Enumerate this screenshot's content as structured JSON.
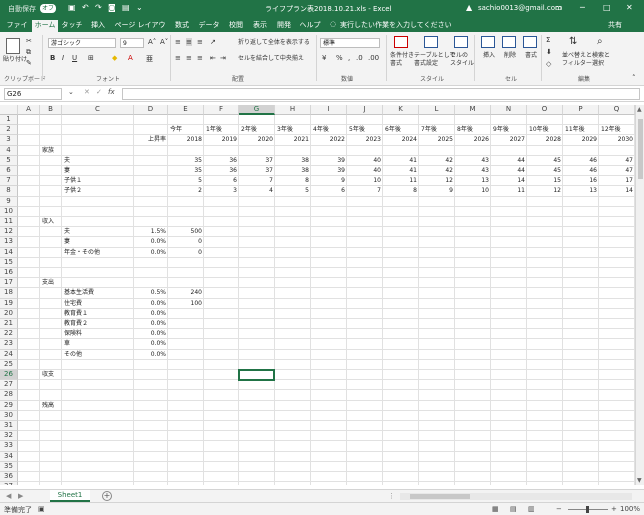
{
  "titlebar": {
    "autosave_label": "自動保存",
    "autosave_state": "オフ",
    "doc_title": "ライフプラン表2018.10.21.xls  -  Excel",
    "user_email": "sachio0013@gmail.com"
  },
  "tabs": [
    "ファイル",
    "ホーム",
    "タッチ",
    "挿入",
    "ページ レイアウト",
    "数式",
    "データ",
    "校閲",
    "表示",
    "開発",
    "ヘルプ"
  ],
  "search_placeholder": "実行したい作業を入力してください",
  "share_label": "共有",
  "ribbon": {
    "paste_label": "貼り付け",
    "font_name": "游ゴシック",
    "font_size": "9",
    "wrap_text": "折り返して全体を表示する",
    "merge_center": "セルを結合して中央揃え",
    "number_format": "標準",
    "cond_format": "条件付き\n書式",
    "table_format": "テーブルとして\n書式設定",
    "cell_styles": "セルの\nスタイル",
    "insert": "挿入",
    "delete": "削除",
    "format": "書式",
    "sort_filter": "並べ替えと\nフィルター",
    "find_select": "検索と\n選択",
    "groups": [
      "クリップボード",
      "フォント",
      "配置",
      "数値",
      "スタイル",
      "セル",
      "編集"
    ]
  },
  "namebox": "G26",
  "columns": [
    "A",
    "B",
    "C",
    "D",
    "E",
    "F",
    "G",
    "H",
    "I",
    "J",
    "K",
    "L",
    "M",
    "N",
    "O",
    "P",
    "Q"
  ],
  "rows": [
    "1",
    "2",
    "3",
    "4",
    "5",
    "6",
    "7",
    "8",
    "9",
    "10",
    "11",
    "12",
    "13",
    "14",
    "15",
    "16",
    "17",
    "18",
    "19",
    "20",
    "21",
    "22",
    "23",
    "24",
    "25",
    "26",
    "27",
    "28",
    "29",
    "30",
    "31",
    "32",
    "33",
    "34",
    "35",
    "36",
    "37"
  ],
  "sheet": {
    "row2": {
      "D": "",
      "E": "今年",
      "F": "1年後",
      "G": "2年後",
      "H": "3年後",
      "I": "4年後",
      "J": "5年後",
      "K": "6年後",
      "L": "7年後",
      "M": "8年後",
      "N": "9年後",
      "O": "10年後",
      "P": "11年後",
      "Q": "12年後"
    },
    "row3": {
      "D": "上昇率",
      "E": "2018",
      "F": "2019",
      "G": "2020",
      "H": "2021",
      "I": "2022",
      "J": "2023",
      "K": "2024",
      "L": "2025",
      "M": "2026",
      "N": "2027",
      "O": "2028",
      "P": "2029",
      "Q": "2030"
    },
    "row4": {
      "B": "家族"
    },
    "row5": {
      "C": "夫",
      "E": "35",
      "F": "36",
      "G": "37",
      "H": "38",
      "I": "39",
      "J": "40",
      "K": "41",
      "L": "42",
      "M": "43",
      "N": "44",
      "O": "45",
      "P": "46",
      "Q": "47"
    },
    "row6": {
      "C": "妻",
      "E": "35",
      "F": "36",
      "G": "37",
      "H": "38",
      "I": "39",
      "J": "40",
      "K": "41",
      "L": "42",
      "M": "43",
      "N": "44",
      "O": "45",
      "P": "46",
      "Q": "47"
    },
    "row7": {
      "C": "子供１",
      "E": "5",
      "F": "6",
      "G": "7",
      "H": "8",
      "I": "9",
      "J": "10",
      "K": "11",
      "L": "12",
      "M": "13",
      "N": "14",
      "O": "15",
      "P": "16",
      "Q": "17"
    },
    "row8": {
      "C": "子供２",
      "E": "2",
      "F": "3",
      "G": "4",
      "H": "5",
      "I": "6",
      "J": "7",
      "K": "8",
      "L": "9",
      "M": "10",
      "N": "11",
      "O": "12",
      "P": "13",
      "Q": "14"
    },
    "row11": {
      "B": "収入"
    },
    "row12": {
      "C": "夫",
      "D": "1.5%",
      "E": "500"
    },
    "row13": {
      "C": "妻",
      "D": "0.0%",
      "E": "0"
    },
    "row14": {
      "C": "年金・その他",
      "D": "0.0%",
      "E": "0"
    },
    "row17": {
      "B": "支出"
    },
    "row18": {
      "C": "基本生活費",
      "D": "0.5%",
      "E": "240"
    },
    "row19": {
      "C": "住宅費",
      "D": "0.0%",
      "E": "100"
    },
    "row20": {
      "C": "教育費１",
      "D": "0.0%"
    },
    "row21": {
      "C": "教育費２",
      "D": "0.0%"
    },
    "row22": {
      "C": "保険料",
      "D": "0.0%"
    },
    "row23": {
      "C": "車",
      "D": "0.0%"
    },
    "row24": {
      "C": "その他",
      "D": "0.0%"
    },
    "row26": {
      "B": "収支"
    },
    "row29": {
      "B": "残高"
    }
  },
  "sheet_tab": "Sheet1",
  "status": {
    "ready": "準備完了",
    "zoom": "100%"
  }
}
